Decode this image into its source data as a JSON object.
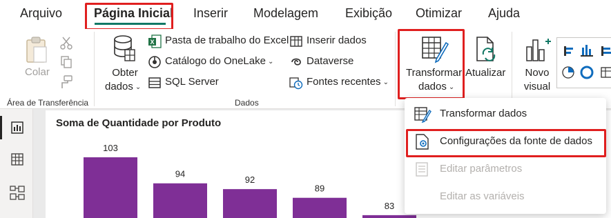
{
  "menu": {
    "tabs": [
      {
        "label": "Arquivo"
      },
      {
        "label": "Página Inicial",
        "active": true
      },
      {
        "label": "Inserir"
      },
      {
        "label": "Modelagem"
      },
      {
        "label": "Exibição"
      },
      {
        "label": "Otimizar"
      },
      {
        "label": "Ajuda"
      }
    ]
  },
  "ribbon": {
    "clipboard": {
      "paste_label": "Colar",
      "group_label": "Área de Transferência"
    },
    "data": {
      "get_data_line1": "Obter",
      "get_data_line2": "dados",
      "excel_label": "Pasta de trabalho do Excel",
      "onelake_label": "Catálogo do OneLake",
      "sql_label": "SQL Server",
      "enter_data_label": "Inserir dados",
      "dataverse_label": "Dataverse",
      "recent_label": "Fontes recentes",
      "group_label": "Dados"
    },
    "queries": {
      "transform_line1": "Transformar",
      "transform_line2": "dados",
      "refresh_label": "Atualizar"
    },
    "visual": {
      "new_visual_line1": "Novo",
      "new_visual_line2": "visual"
    }
  },
  "dropdown": {
    "items": [
      {
        "label": "Transformar dados",
        "enabled": true,
        "icon": "transform-data-icon"
      },
      {
        "label": "Configurações da fonte de dados",
        "enabled": true,
        "icon": "data-source-settings-icon"
      },
      {
        "label": "Editar parâmetros",
        "enabled": false,
        "icon": "edit-parameters-icon"
      },
      {
        "label": "Editar as variáveis",
        "enabled": false,
        "icon": ""
      }
    ]
  },
  "colors": {
    "accent": "#117865",
    "highlight_box": "#e01f1f",
    "bar": "#7f2f96",
    "excel_green": "#217346"
  },
  "chart_data": {
    "type": "bar",
    "title": "Soma de Quantidade por Produto",
    "values": [
      103,
      94,
      92,
      89,
      83
    ],
    "note": "Category labels and lower part of bars are cropped out of view."
  }
}
